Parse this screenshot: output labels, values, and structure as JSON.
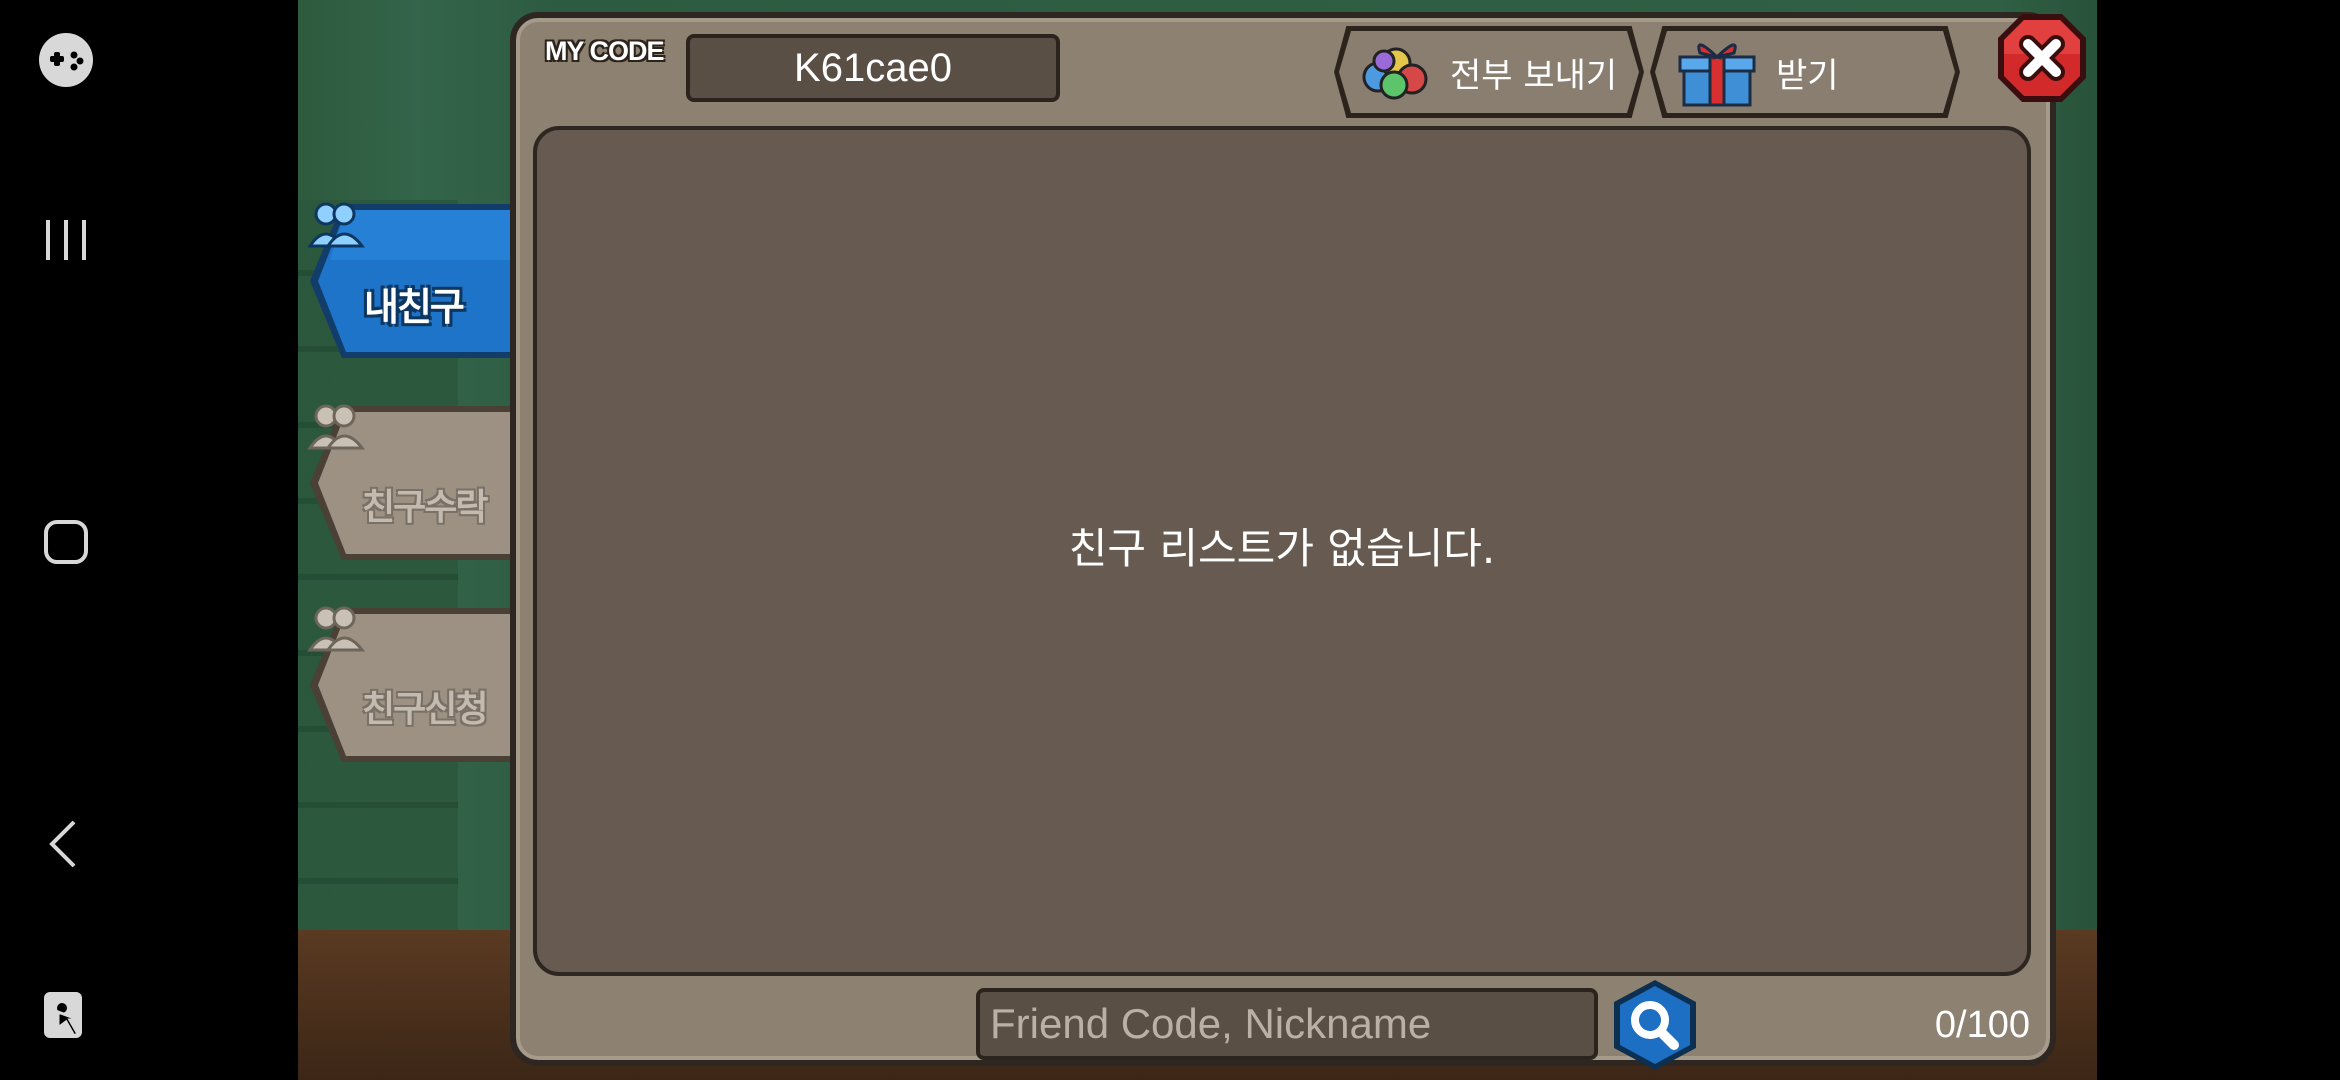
{
  "android_nav": {
    "icons": [
      "game-launcher-icon",
      "recent-apps-icon",
      "home-icon",
      "back-icon",
      "screen-touch-lock-icon"
    ]
  },
  "tabs": [
    {
      "label": "내친구",
      "active": true
    },
    {
      "label": "친구수락",
      "active": false
    },
    {
      "label": "친구신청",
      "active": false
    }
  ],
  "header": {
    "my_code_label": "MY CODE",
    "my_code_value": "K61cae0",
    "send_all_label": "전부 보내기",
    "receive_label": "받기"
  },
  "list": {
    "empty_message": "친구 리스트가 없습니다."
  },
  "search": {
    "placeholder": "Friend Code, Nickname",
    "count": "0/100"
  },
  "colors": {
    "panel": "#8d8172",
    "list_bg": "#675b51",
    "active_tab": "#1d6fc0",
    "inactive_tab": "#9b9081",
    "close_red": "#d62a2a"
  }
}
